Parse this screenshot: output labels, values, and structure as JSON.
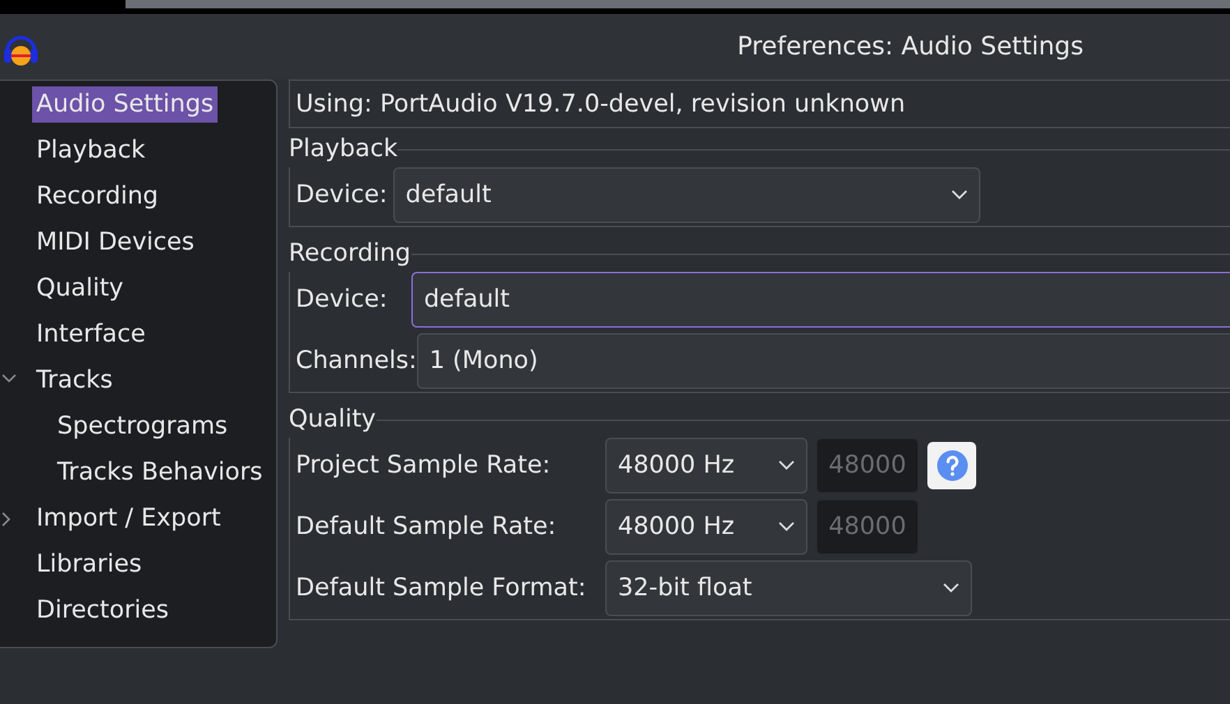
{
  "window": {
    "title": "Preferences: Audio Settings"
  },
  "sidebar": {
    "items": [
      {
        "label": "Audio Settings",
        "selected": true
      },
      {
        "label": "Playback",
        "selected": false
      },
      {
        "label": "Recording",
        "selected": false
      },
      {
        "label": "MIDI Devices",
        "selected": false
      },
      {
        "label": "Quality",
        "selected": false
      },
      {
        "label": "Interface",
        "selected": false
      },
      {
        "label": "Tracks",
        "selected": false,
        "expanded": true,
        "children": [
          {
            "label": "Spectrograms",
            "selected": false
          },
          {
            "label": "Tracks Behaviors",
            "selected": false
          }
        ]
      },
      {
        "label": "Import / Export",
        "selected": false,
        "expanded": false
      },
      {
        "label": "Libraries",
        "selected": false
      },
      {
        "label": "Directories",
        "selected": false
      }
    ]
  },
  "host_info": "Using: PortAudio V19.7.0-devel, revision unknown",
  "playback": {
    "title": "Playback",
    "device": {
      "label": "Device:",
      "value": "default"
    }
  },
  "recording": {
    "title": "Recording",
    "device": {
      "label": "Device:",
      "value": "default",
      "focused": true
    },
    "channels": {
      "label": "Channels:",
      "value": "1 (Mono)",
      "focused": false
    }
  },
  "quality": {
    "title": "Quality",
    "rows": [
      {
        "kind": "rate",
        "label": "Project Sample Rate:",
        "value": "48000 Hz",
        "custom": "48000",
        "help": true
      },
      {
        "kind": "rate",
        "label": "Default Sample Rate:",
        "value": "48000 Hz",
        "custom": "48000",
        "help": false
      },
      {
        "kind": "format",
        "label": "Default Sample Format:",
        "value": "32-bit float"
      }
    ]
  }
}
